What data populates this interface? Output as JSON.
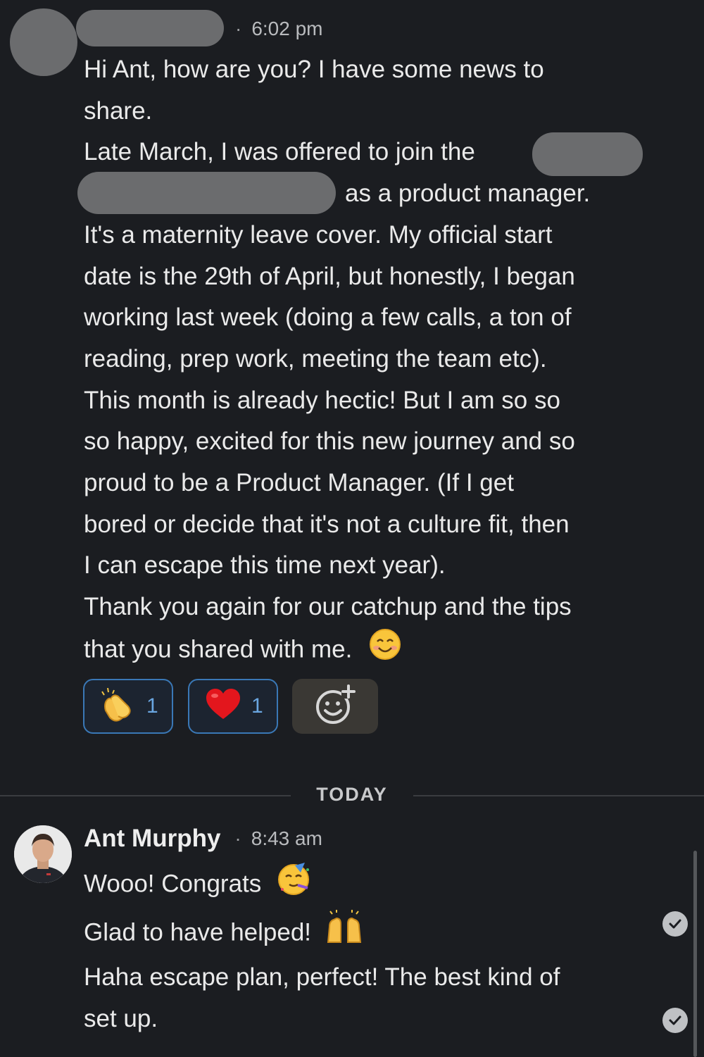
{
  "messages": [
    {
      "time": "6:02 pm",
      "lines": [
        "Hi Ant, how are you? I have some news to",
        "share.",
        "Late March, I was offered to join the",
        "as a product manager.",
        "It's a maternity leave cover. My official start",
        "date is the 29th of April, but honestly, I began",
        "working last week (doing a few calls, a ton of",
        "reading, prep work, meeting the team etc).",
        "This month is already hectic! But I am so so",
        "so happy, excited for this new journey and so",
        "proud to be a Product Manager. (If I get",
        "bored or decide that it's not a culture fit, then",
        "I can escape this time next year).",
        "Thank you again for our catchup and the tips",
        "that you shared with me."
      ],
      "reactions": [
        {
          "emoji": "clapping-hands",
          "count": "1"
        },
        {
          "emoji": "red-heart",
          "count": "1"
        }
      ]
    }
  ],
  "separator": "TODAY",
  "reply": {
    "author": "Ant Murphy",
    "time": "8:43 am",
    "lines": [
      "Wooo! Congrats",
      "Glad to have helped!"
    ],
    "followup_lines": [
      "Haha escape plan, perfect! The best kind of",
      "set up."
    ]
  },
  "colors": {
    "background": "#1b1d21",
    "reaction_border": "#3a78b6",
    "reaction_count": "#6aa6e0",
    "redaction": "#6b6c6e"
  }
}
